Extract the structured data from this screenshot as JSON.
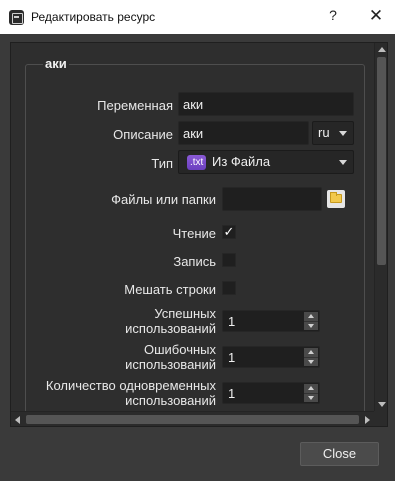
{
  "window": {
    "title": "Редактировать ресурс",
    "help_label": "?",
    "close_label": "✕"
  },
  "group": {
    "title": "аки"
  },
  "form": {
    "variable": {
      "label": "Переменная",
      "value": "аки"
    },
    "description": {
      "label": "Описание",
      "value": "аки",
      "language": "ru"
    },
    "type": {
      "label": "Тип",
      "badge": ".txt",
      "value": "Из Файла"
    },
    "files": {
      "label": "Файлы или папки",
      "value": ""
    },
    "read": {
      "label": "Чтение",
      "checked": true,
      "mark": "✓"
    },
    "write": {
      "label": "Запись",
      "checked": false
    },
    "shuffle": {
      "label": "Мешать строки",
      "checked": false
    },
    "success_uses": {
      "label_line1": "Успешных",
      "label_line2": "использований",
      "value": "1"
    },
    "error_uses": {
      "label_line1": "Ошибочных",
      "label_line2": "использований",
      "value": "1"
    },
    "concurrent_uses": {
      "label_line1": "Количество одновременных",
      "label_line2": "использований",
      "value": "1"
    }
  },
  "footer": {
    "close_label": "Close"
  }
}
